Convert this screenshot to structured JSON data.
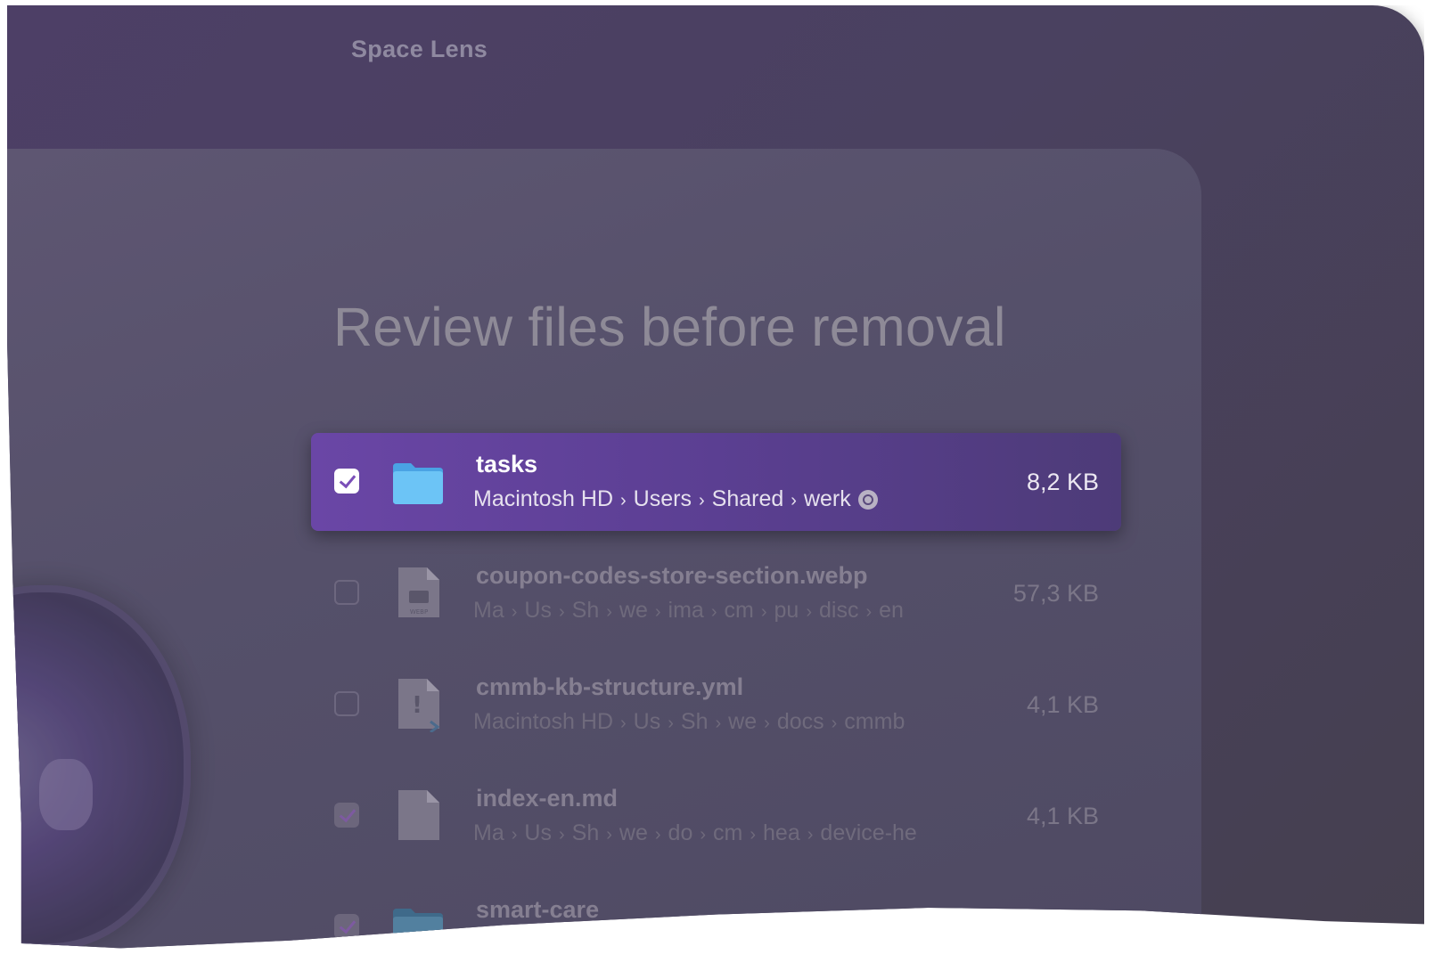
{
  "app": {
    "title": "Space Lens"
  },
  "main": {
    "heading": "Review files before removal"
  },
  "files": [
    {
      "name": "tasks",
      "path": [
        "Macintosh HD",
        "Users",
        "Shared",
        "werk"
      ],
      "size": "8,2 KB",
      "checked": true,
      "icon": "folder-icon"
    },
    {
      "name": "coupon-codes-store-section.webp",
      "path": [
        "Ma",
        "Us",
        "Sh",
        "we",
        "ima",
        "cm",
        "pu",
        "disc",
        "en"
      ],
      "size": "57,3 KB",
      "checked": false,
      "icon": "webp-file-icon"
    },
    {
      "name": "cmmb-kb-structure.yml",
      "path": [
        "Macintosh HD",
        "Us",
        "Sh",
        "we",
        "docs",
        "cmmb"
      ],
      "size": "4,1 KB",
      "checked": false,
      "icon": "yml-file-icon"
    },
    {
      "name": "index-en.md",
      "path": [
        "Ma",
        "Us",
        "Sh",
        "we",
        "do",
        "cm",
        "hea",
        "device-he"
      ],
      "size": "4,1 KB",
      "checked": true,
      "icon": "md-file-icon"
    },
    {
      "name": "smart-care",
      "path": [],
      "size": "",
      "checked": true,
      "icon": "folder-icon"
    }
  ],
  "colors": {
    "accent": "#6a46a6",
    "checkmark": "#7b4fb8",
    "folder": "#5cb8f2"
  }
}
